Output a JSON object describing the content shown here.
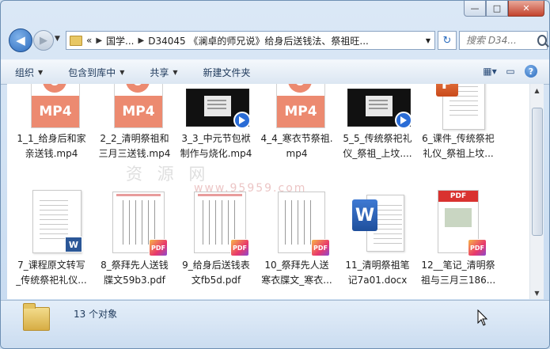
{
  "window": {
    "minimize_label": "—",
    "maximize_label": "□",
    "close_label": "✕"
  },
  "nav": {
    "breadcrumb": [
      {
        "label": "«"
      },
      {
        "label": "国学..."
      },
      {
        "label": "D34045 《澜卓的师兄说》给身后送钱法、祭祖旺..."
      }
    ],
    "search_placeholder": "搜索 D34..."
  },
  "toolbar": {
    "items": [
      {
        "label": "组织",
        "dropdown": true
      },
      {
        "label": "包含到库中",
        "dropdown": true
      },
      {
        "label": "共享",
        "dropdown": true
      },
      {
        "label": "新建文件夹",
        "dropdown": false
      }
    ]
  },
  "files": [
    {
      "name_l1": "1_1_给身后和家",
      "name_l2": "亲送钱.mp4",
      "type": "mp4",
      "icon": "mp4-icon"
    },
    {
      "name_l1": "2_2_清明祭祖和",
      "name_l2": "三月三送钱.mp4",
      "type": "mp4",
      "icon": "mp4-icon"
    },
    {
      "name_l1": "3_3_中元节包袱",
      "name_l2": "制作与烧化.mp4",
      "type": "video",
      "icon": "video-thumbnail-icon"
    },
    {
      "name_l1": "4_4_寒衣节祭祖.",
      "name_l2": "mp4",
      "type": "mp4",
      "icon": "mp4-icon"
    },
    {
      "name_l1": "5_5_传统祭祀礼",
      "name_l2": "仪_祭祖_上坟....",
      "type": "video",
      "icon": "video-thumbnail-icon"
    },
    {
      "name_l1": "6_课件_传统祭祀",
      "name_l2": "礼仪_祭祖上坟...",
      "type": "ppt",
      "icon": "powerpoint-icon"
    },
    {
      "name_l1": "7_课程原文转写",
      "name_l2": "_传统祭祀礼仪...",
      "type": "doc",
      "icon": "word-document-icon"
    },
    {
      "name_l1": "8_祭拜先人送钱",
      "name_l2": "牒文59b3.pdf",
      "type": "pdf",
      "icon": "pdf-icon"
    },
    {
      "name_l1": "9_给身后送钱表",
      "name_l2": "文fb5d.pdf",
      "type": "pdf",
      "icon": "pdf-icon"
    },
    {
      "name_l1": "10_祭拜先人送",
      "name_l2": "寒衣牒文_寒衣...",
      "type": "pdf",
      "icon": "pdf-icon"
    },
    {
      "name_l1": "11_清明祭祖笔",
      "name_l2": "记7a01.docx",
      "type": "word",
      "icon": "word-docx-icon"
    },
    {
      "name_l1": "12__笔记_清明祭",
      "name_l2": "祖与三月三186...",
      "type": "pdfred",
      "icon": "pdf-icon"
    }
  ],
  "thumb_text": {
    "mp4": "MP4",
    "pdf": "PDF",
    "ppt": "P",
    "word": "W"
  },
  "watermark": {
    "line1": "资 源 网",
    "line2": "www.95959.com"
  },
  "status": {
    "count": "13 个对象"
  }
}
